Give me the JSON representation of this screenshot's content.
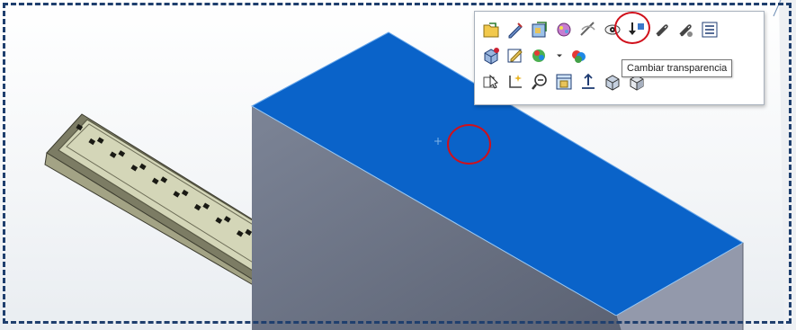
{
  "viewport": {
    "models": [
      "power-strip-part",
      "blue-box-part"
    ]
  },
  "context_toolbar": {
    "rows": [
      [
        "open-part-icon",
        "edit-sketch-icon",
        "edit-feature-icon",
        "appearance-icon",
        "hide-icon",
        "change-transparency-icon",
        "normal-to-icon",
        "mate-icon",
        "smart-mate-icon",
        "properties-icon"
      ],
      [
        "isolate-icon",
        "edit-sketch2-icon",
        "appearances-icon",
        "dropdown-arrow-icon",
        "rebuild-color-icon"
      ],
      [
        "select-other-icon",
        "sketch-icon",
        "zoom-to-selection-icon",
        "view-orientation-icon",
        "normal-view-icon",
        "display-style-icon",
        "shaded-icon"
      ]
    ],
    "tooltip": "Cambiar transparencia"
  },
  "colors": {
    "top_face": "#0a63c9",
    "side_face": "#737b8a",
    "highlight": "#d0101b",
    "frame": "#1f3f6e"
  }
}
